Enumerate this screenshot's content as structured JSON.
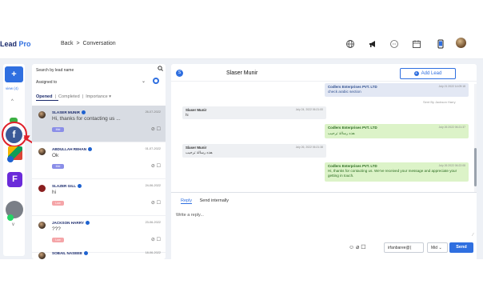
{
  "app": {
    "logo_text": "Lead",
    "logo_suffix": "Pro"
  },
  "breadcrumb": {
    "back": "Back",
    "separator": ">",
    "current": "Conversation"
  },
  "rail": {
    "new_label": "+",
    "view_label": "view (4)"
  },
  "list": {
    "search_placeholder": "Search by lead name",
    "assigned_label": "Assigned to",
    "tabs": {
      "opened": "Opened",
      "completed": "Completed",
      "importance": "Importance ▾"
    },
    "items": [
      {
        "name": "SLASER MUNIR",
        "date": "26-07-2022",
        "message": "Hi, thanks for contacting us ...",
        "priority": "Mid"
      },
      {
        "name": "ABDULLAH REHAN",
        "date": "01-07-2022",
        "message": "Ok",
        "priority": "Mid"
      },
      {
        "name": "SLAZER GILL",
        "date": "24-06-2022",
        "message": "hi",
        "priority": "Low"
      },
      {
        "name": "JACKSON HARRY",
        "date": "23-06-2022",
        "message": "???",
        "priority": "Low"
      },
      {
        "name": "SOBAIL NASEEB",
        "date": "18-06-2022",
        "message": "",
        "priority": ""
      }
    ]
  },
  "chat": {
    "contact_initial": "S",
    "contact_name": "Slaser Munir",
    "add_lead_label": "Add Lead",
    "sent_by": "Sent By Jackson Harry",
    "messages": [
      {
        "sender": "Codlers Enterprises PVT. LTD",
        "time": "July 21 2022 14:09:18",
        "text": "check arabic section"
      },
      {
        "sender": "Slaser Munir",
        "time": "July 24, 2022 06:21:00",
        "text": "hi"
      },
      {
        "sender": "Codlers Enterprises PVT. LTD",
        "time": "July 26 2022 06:21:37",
        "text": "هذه رسالة ترحيب"
      },
      {
        "sender": "Slaser Munir",
        "time": "July 26, 2022 06:21:38",
        "text": "هذه رسالة ترحيب"
      },
      {
        "sender": "Codlers Enterprises PVT. LTD",
        "time": "July 26 2022 06:22:08",
        "text": "Hi, thanks for contacting us. We've received your message and appreciate your getting in touch."
      }
    ]
  },
  "reply": {
    "tab_reply": "Reply",
    "tab_internal": "Send internally",
    "placeholder": "Write a reply...",
    "assignee": "irfanbaree@(",
    "priority": "Mid",
    "send_label": "Send"
  },
  "colors": {
    "accent": "#2f6fe0",
    "brand": "#1a2a6c",
    "highlight": "#e0202a"
  }
}
